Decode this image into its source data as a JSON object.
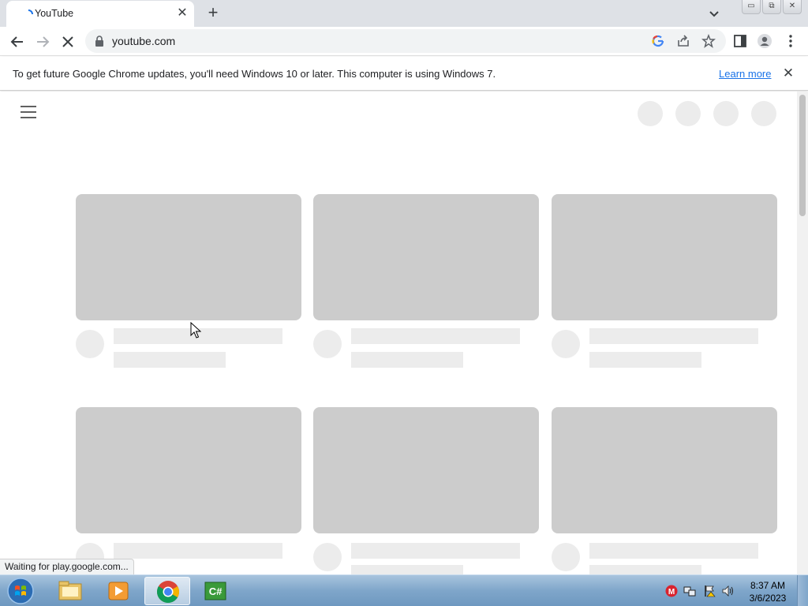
{
  "browser": {
    "tab": {
      "title": "YouTube",
      "close_glyph": "✕"
    },
    "new_tab_glyph": "+",
    "window_buttons": [
      "▭",
      "⧉",
      "✕"
    ],
    "url": "youtube.com"
  },
  "infobar": {
    "message": "To get future Google Chrome updates, you'll need Windows 10 or later. This computer is using Windows 7.",
    "link": "Learn more",
    "close_glyph": "✕"
  },
  "page": {
    "icons": [
      "menu-icon"
    ],
    "loading_placeholders": true
  },
  "status_text": "Waiting for play.google.com...",
  "taskbar": {
    "items": [
      "start-orb",
      "file-explorer",
      "media-player",
      "google-chrome",
      "csharp-app"
    ],
    "active": "google-chrome",
    "time": "8:37 AM",
    "date": "3/6/2023"
  },
  "colors": {
    "accent_link": "#1a73e8",
    "placeholder_thumb": "#cccccc",
    "placeholder_line": "#ececec"
  }
}
